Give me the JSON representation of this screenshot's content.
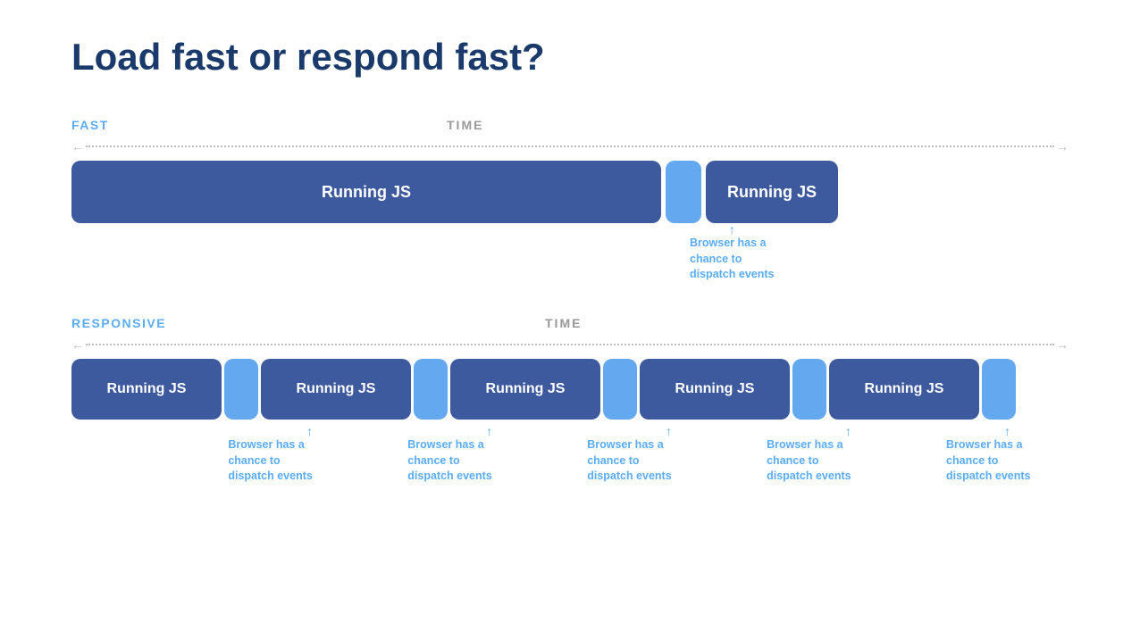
{
  "title": "Load fast or respond fast?",
  "fast_section": {
    "label": "FAST",
    "time_label": "TIME",
    "block1_text": "Running JS",
    "block2_text": "Running JS",
    "annotation": "Browser has a\nchance to\ndispatch events"
  },
  "responsive_section": {
    "label": "RESPONSIVE",
    "time_label": "TIME",
    "blocks": [
      "Running JS",
      "Running JS",
      "Running JS",
      "Running JS",
      "Running JS"
    ],
    "annotation": "Browser has a\nchance to\ndispatch events",
    "annotation_count": 5
  },
  "colors": {
    "title": "#1a3a6b",
    "label_blue": "#5aacf5",
    "label_time": "#999",
    "block_dark": "#3d5a9e",
    "block_light": "#64a8f0",
    "annotation": "#5aacf5",
    "arrow": "#bbb"
  }
}
